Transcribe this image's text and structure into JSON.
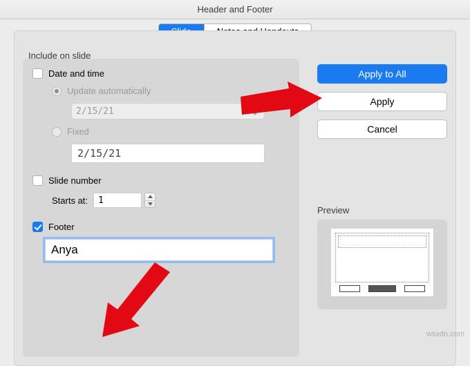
{
  "window_title": "Header and Footer",
  "tabs": {
    "slide": "Slide",
    "notes": "Notes and Handouts"
  },
  "section_label": "Include on slide",
  "date_time": {
    "label": "Date and time",
    "update_auto": "Update automatically",
    "auto_value": "2/15/21",
    "fixed_label": "Fixed",
    "fixed_value": "2/15/21"
  },
  "slide_number": {
    "label": "Slide number",
    "starts_at_label": "Starts at:",
    "starts_at_value": "1"
  },
  "footer": {
    "label": "Footer",
    "value": "Anya"
  },
  "buttons": {
    "apply_all": "Apply to All",
    "apply": "Apply",
    "cancel": "Cancel"
  },
  "preview_label": "Preview",
  "watermark": "wsxdn.com"
}
